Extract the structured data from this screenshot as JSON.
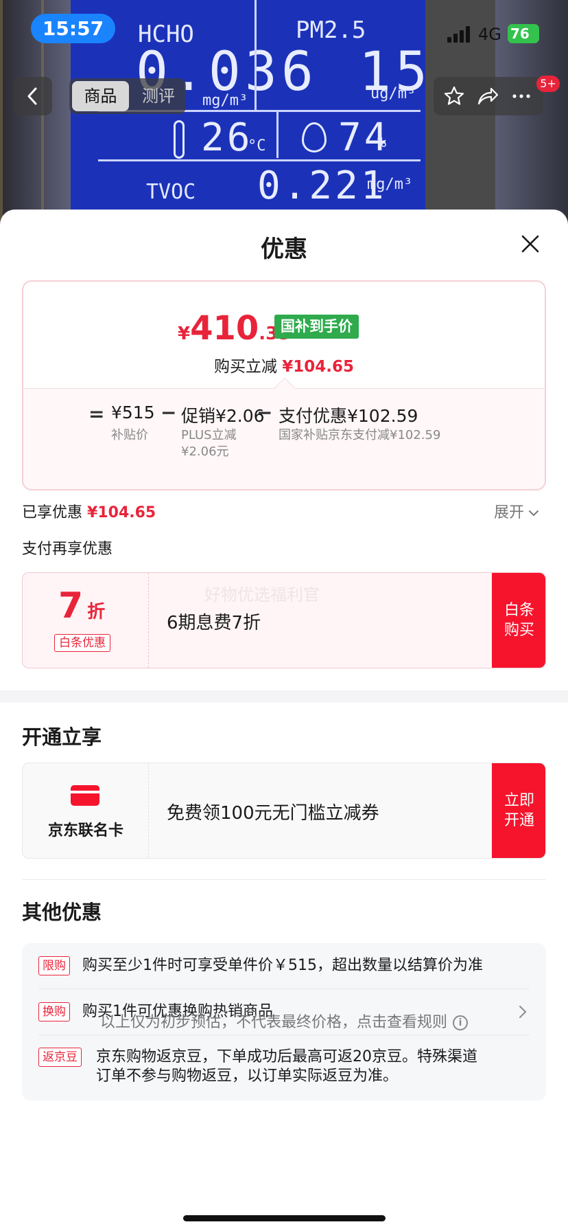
{
  "background": {
    "lcd": {
      "hcho_label": "HCHO",
      "hcho_value": "0.036",
      "hcho_unit": "mg/m³",
      "pm25_label": "PM2.5",
      "pm25_value": "15",
      "pm25_unit": "ug/m³",
      "temp_value": "26",
      "temp_unit": "°C",
      "humidity_value": "74",
      "humidity_unit": "%",
      "tvoc_label": "TVOC",
      "tvoc_value": "0.221",
      "tvoc_unit": "mg/m³"
    }
  },
  "status_bar": {
    "time": "15:57",
    "network": "4G",
    "battery": "76"
  },
  "nav": {
    "tab_product": "商品",
    "tab_review": "测评",
    "badge": "5+",
    "icons": [
      "back-icon",
      "star-icon",
      "share-icon",
      "more-icon"
    ]
  },
  "sheet": {
    "title": "优惠",
    "price": {
      "yen": "¥",
      "integer": "410",
      "decimal": ".35",
      "tag": "国补到手价",
      "reduce_label": "购买立减",
      "reduce_value": "¥104.65"
    },
    "calc": {
      "eq": "=",
      "base_value": "¥515",
      "base_label": "补贴价",
      "minus1": "−",
      "promo_value": "促销¥2.06",
      "promo_label_1": "PLUS立减",
      "promo_label_2": "¥2.06元",
      "minus2": "−",
      "pay_value": "支付优惠¥102.59",
      "pay_label": "国家补贴京东支付减¥102.59"
    },
    "enjoyed_label": "已享优惠",
    "enjoyed_value": "¥104.65",
    "expand": "展开",
    "pay_more_title": "支付再享优惠",
    "baitiao": {
      "discount_num": "7",
      "discount_unit": "折",
      "tag": "白条优惠",
      "watermark": "好物优选福利官",
      "desc": "6期息费7折",
      "action_1": "白条",
      "action_2": "购买"
    },
    "open_title": "开通立享",
    "card": {
      "name": "京东联名卡",
      "desc": "免费领100元无门槛立减券",
      "action_1": "立即",
      "action_2": "开通"
    },
    "other_title": "其他优惠",
    "others": [
      {
        "tag": "限购",
        "text": "购买至少1件时可享受单件价￥515，超出数量以结算价为准"
      },
      {
        "tag": "换购",
        "text": "购买1件可优惠换购热销商品"
      },
      {
        "tag": "返京豆",
        "text_1": "京东购物返京豆，下单成功后最高可返20京豆。特殊渠道",
        "text_2": "订单不参与购物返豆，以订单实际返豆为准。"
      }
    ],
    "footer": "以上仅为初步预估，不代表最终价格，点击查看规则",
    "info_icon": "i"
  },
  "colors": {
    "accent_red": "#e8243a",
    "action_red": "#f5142c",
    "tag_green": "#2faa4d",
    "time_blue": "#1a84ff",
    "lcd_blue": "#1b32b8"
  }
}
